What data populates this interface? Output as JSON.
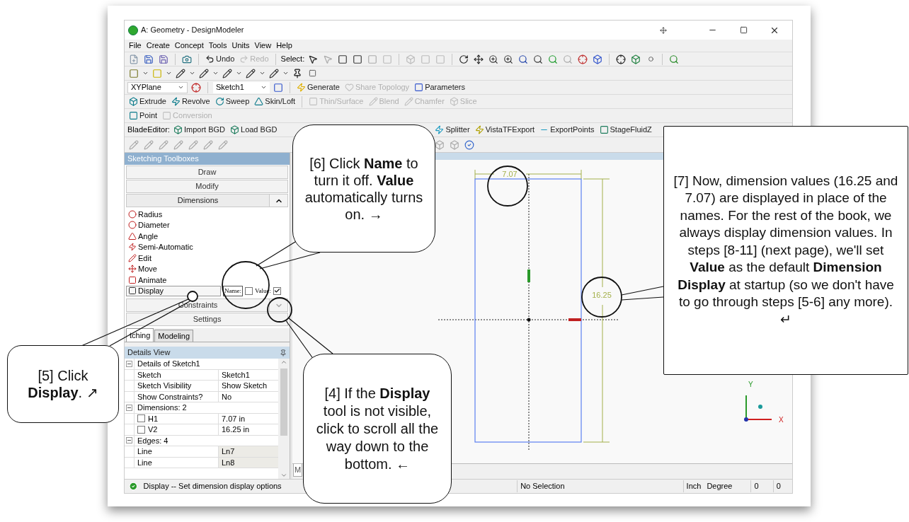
{
  "window": {
    "title": "A: Geometry - DesignModeler"
  },
  "menu": [
    "File",
    "Create",
    "Concept",
    "Tools",
    "Units",
    "View",
    "Help"
  ],
  "main_toolbar": {
    "undo": "Undo",
    "redo": "Redo",
    "select_label": "Select:"
  },
  "plane_toolbar": {
    "plane": "XYPlane",
    "sketch": "Sketch1",
    "buttons": [
      {
        "label": "Generate",
        "disabled": false
      },
      {
        "label": "Share Topology",
        "disabled": true
      },
      {
        "label": "Parameters",
        "disabled": false
      }
    ]
  },
  "features_toolbar": [
    {
      "label": "Extrude",
      "disabled": false
    },
    {
      "label": "Revolve",
      "disabled": false
    },
    {
      "label": "Sweep",
      "disabled": false
    },
    {
      "label": "Skin/Loft",
      "disabled": false
    },
    {
      "label": "Thin/Surface",
      "disabled": true
    },
    {
      "label": "Blend",
      "disabled": true
    },
    {
      "label": "Chamfer",
      "disabled": true
    },
    {
      "label": "Slice",
      "disabled": true
    }
  ],
  "point_toolbar": [
    {
      "label": "Point",
      "disabled": false
    },
    {
      "label": "Conversion",
      "disabled": true
    }
  ],
  "blade_editor": {
    "label": "BladeEditor:",
    "buttons": [
      "Import BGD",
      "Load BGD",
      "Splitter",
      "VistaTFExport",
      "ExportPoints",
      "StageFluidZ"
    ]
  },
  "sketching_toolboxes": {
    "title": "Sketching Toolboxes",
    "sections": [
      {
        "label": "Draw",
        "expanded": false
      },
      {
        "label": "Modify",
        "expanded": false
      },
      {
        "label": "Dimensions",
        "expanded": true
      },
      {
        "label": "Constraints",
        "expanded": false
      },
      {
        "label": "Settings",
        "expanded": false
      }
    ],
    "tools": [
      {
        "kind": "tool",
        "label": "Radius",
        "selected": false
      },
      {
        "kind": "tool",
        "label": "Diameter",
        "selected": false
      },
      {
        "kind": "tool",
        "label": "Angle",
        "selected": false
      },
      {
        "kind": "tool",
        "label": "Semi-Automatic",
        "selected": false
      },
      {
        "kind": "tool",
        "label": "Edit",
        "selected": false
      },
      {
        "kind": "tool",
        "label": "Move",
        "selected": false
      },
      {
        "kind": "tool",
        "label": "Animate",
        "selected": false
      },
      {
        "kind": "display",
        "label": "Display",
        "selected": true,
        "name_label": "Name:",
        "name_checked": false,
        "value_label": "Value:",
        "value_checked": true
      }
    ]
  },
  "panel_tabs": [
    {
      "label": "tching",
      "selected": true
    },
    {
      "label": "Modeling",
      "selected": false
    }
  ],
  "details_view": {
    "title": "Details View",
    "groups": [
      {
        "label": "Details of Sketch1",
        "expanded": true,
        "rows": [
          {
            "kind": "text",
            "property": "Sketch",
            "value": "Sketch1"
          },
          {
            "kind": "text",
            "property": "Sketch Visibility",
            "value": "Show Sketch"
          },
          {
            "kind": "text",
            "property": "Show Constraints?",
            "value": "No"
          }
        ]
      },
      {
        "label": "Dimensions: 2",
        "expanded": true,
        "rows": [
          {
            "kind": "checkbox",
            "checked": false,
            "property": "H1",
            "value": "7.07 in"
          },
          {
            "kind": "checkbox",
            "checked": false,
            "property": "V2",
            "value": "16.25 in"
          }
        ]
      },
      {
        "label": "Edges: 4",
        "expanded": true,
        "rows": [
          {
            "kind": "readonly",
            "property": "Line",
            "value": "Ln7"
          },
          {
            "kind": "readonly",
            "property": "Line",
            "value": "Ln8"
          }
        ]
      }
    ]
  },
  "graphics": {
    "width_dimension": "7.07",
    "height_dimension": "16.25",
    "axis_y": "Y",
    "axis_x": "X",
    "tab": "M"
  },
  "status_bar": {
    "message": "Display -- Set dimension display options",
    "selection": "No Selection",
    "length_unit": "Inch",
    "angle_unit": "Degree",
    "field_1": "0",
    "field_2": "0"
  },
  "callouts": [
    {
      "text": "[6] Click **Name** to turn it off. **Value** automatically turns on.  →"
    },
    {
      "text": "[7] Now, dimension values (16.25 and 7.07) are displayed in place of the names.  For the rest of the book, we always display dimension values.  In steps [8-11] (next page), we'll set **Value** as the default **Dimension Display** at startup (so we don't have to go through steps [5-6] any more).  ↵"
    },
    {
      "text": "[5] Click **Display**.  ↗"
    },
    {
      "text": "[4] If the **Display** tool is not visible, click to scroll all the way down to the bottom.  ←"
    }
  ]
}
